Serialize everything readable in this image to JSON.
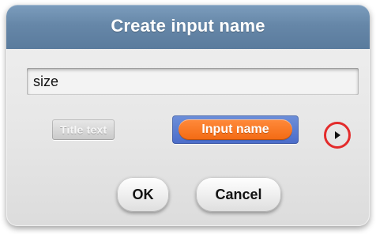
{
  "dialog": {
    "title": "Create input name",
    "input": {
      "value": "size",
      "placeholder": ""
    },
    "options": {
      "title_text_label": "Title text",
      "input_name_label": "Input name"
    },
    "buttons": {
      "ok_label": "OK",
      "cancel_label": "Cancel"
    },
    "icons": {
      "expand": "chevron-right-icon"
    },
    "colors": {
      "titlebar": "#6687a8",
      "input_block": "#4b6cc9",
      "input_name_pill": "#f36a13",
      "highlight_circle": "#e32b2b"
    }
  }
}
